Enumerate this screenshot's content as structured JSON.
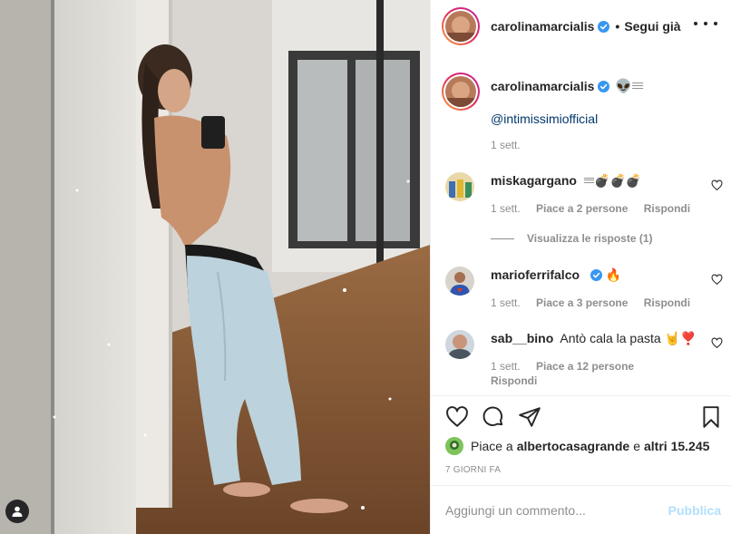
{
  "post": {
    "author": "carolinamarcialis",
    "follow_separator": "•",
    "follow_status": "Segui già",
    "caption_emoji": "👽𝄘",
    "caption_mention": "@intimissimiofficial",
    "caption_time": "1 sett."
  },
  "comments": [
    {
      "username": "miskagargano",
      "text": "𝄘💣💣💣",
      "time": "1 sett.",
      "likes": "Piace a 2 persone",
      "reply": "Rispondi",
      "view_replies": "Visualizza le risposte (1)"
    },
    {
      "username": "marioferrifalco",
      "text": "🔥",
      "time": "1 sett.",
      "likes": "Piace a 3 persone",
      "reply": "Rispondi"
    },
    {
      "username": "sab__bino",
      "text": "Antò cala la pasta 🤘❣️",
      "time": "1 sett.",
      "likes": "Piace a 12 persone",
      "reply": "Rispondi"
    }
  ],
  "actions": {
    "like_icon": "heart-icon",
    "comment_icon": "comment-icon",
    "share_icon": "paper-plane-icon",
    "save_icon": "bookmark-icon"
  },
  "likes": {
    "prefix": "Piace a",
    "user": "albertocasagrande",
    "connector": "e",
    "others": "altri 15.245"
  },
  "post_date": "7 GIORNI FA",
  "add_comment": {
    "placeholder": "Aggiungi un commento...",
    "publish_label": "Pubblica"
  },
  "colors": {
    "verified": "#3897f0",
    "link": "#00376b",
    "muted": "#8e8e8e",
    "publish_disabled": "#b2dffc"
  }
}
